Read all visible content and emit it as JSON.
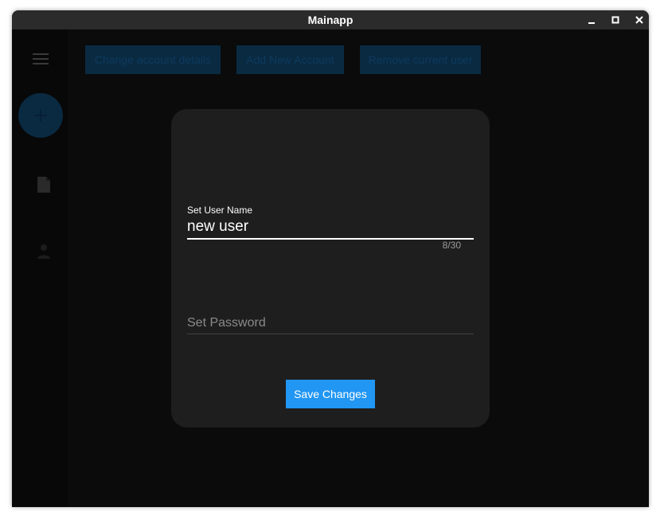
{
  "window": {
    "title": "Mainapp"
  },
  "icons": {
    "minimize": "minimize-icon",
    "maximize": "maximize-icon",
    "close": "close-icon",
    "menu": "menu-icon",
    "add": "plus-icon",
    "document": "document-icon",
    "user": "person-icon"
  },
  "toolbar": {
    "change_account": "Change account details",
    "add_account": "Add New Account",
    "remove_user": "Remove current user"
  },
  "dialog": {
    "username_label": "Set User Name",
    "username_value": "new user",
    "username_counter": "8/30",
    "password_placeholder": "Set Password",
    "password_value": "",
    "save_label": "Save Changes"
  },
  "colors": {
    "accent": "#2196f3",
    "dialog_bg": "#1e1e1e",
    "dimmed_button": "#0a2a42"
  }
}
